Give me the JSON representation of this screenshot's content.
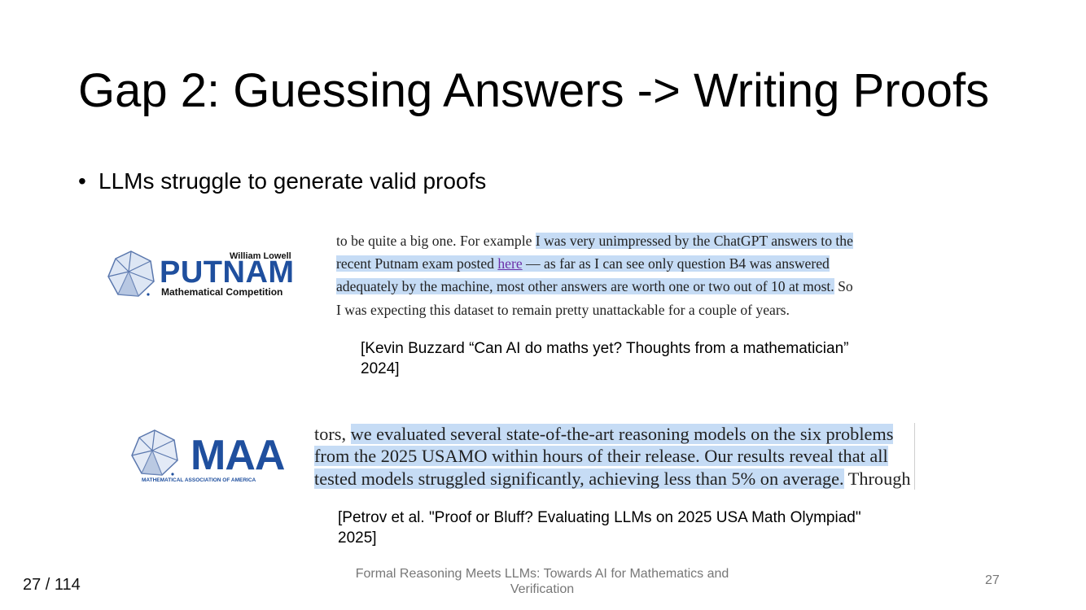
{
  "slide": {
    "title": "Gap 2: Guessing Answers -> Writing Proofs",
    "bullet": "LLMs struggle to generate valid proofs"
  },
  "putnam_logo": {
    "top_text": "William Lowell",
    "main_text": "PUTNAM",
    "sub_text": "Mathematical Competition",
    "brand_color": "#1f4f9e",
    "icon": "polyhedron-icon"
  },
  "excerpt_1": {
    "lines": [
      {
        "plain": "to be quite a big one. For example ",
        "highlight": "I was very unimpressed by the ChatGPT answers to the"
      },
      {
        "highlight_a": "recent Putnam exam posted ",
        "link": "here",
        "highlight_b": " — as far as I can see only question B4 was answered"
      },
      {
        "highlight": "adequately by the machine, most other answers are worth one or two out of 10 at most.",
        "plain": " So"
      },
      {
        "plain": "I was expecting this dataset to remain pretty unattackable for a couple of years."
      }
    ],
    "highlight_color": "#c6dcf5"
  },
  "citation_1": {
    "line1": "[Kevin Buzzard “Can AI do maths yet? Thoughts from a mathematician”",
    "line2": "2024]"
  },
  "maa_logo": {
    "main_text": "MAA",
    "sub_text": "MATHEMATICAL ASSOCIATION OF AMERICA",
    "brand_color": "#1f4f9e",
    "icon": "polyhedron-icon"
  },
  "excerpt_2": {
    "lines": [
      {
        "plain": "tors, ",
        "highlight": "we evaluated several state-of-the-art reasoning models on the six problems"
      },
      {
        "highlight": "from the 2025 USAMO within hours of their release.  Our results reveal that all"
      },
      {
        "highlight": "tested models struggled significantly, achieving less than 5% on average.",
        "plain": " Through"
      }
    ]
  },
  "citation_2": {
    "line1": "[Petrov et al. \"Proof or Bluff? Evaluating LLMs on 2025 USA Math Olympiad\"",
    "line2": "2025]"
  },
  "footer": {
    "page_counter": "27 / 114",
    "title": "Formal Reasoning Meets LLMs: Towards AI for Mathematics and Verification",
    "slide_number": "27"
  }
}
